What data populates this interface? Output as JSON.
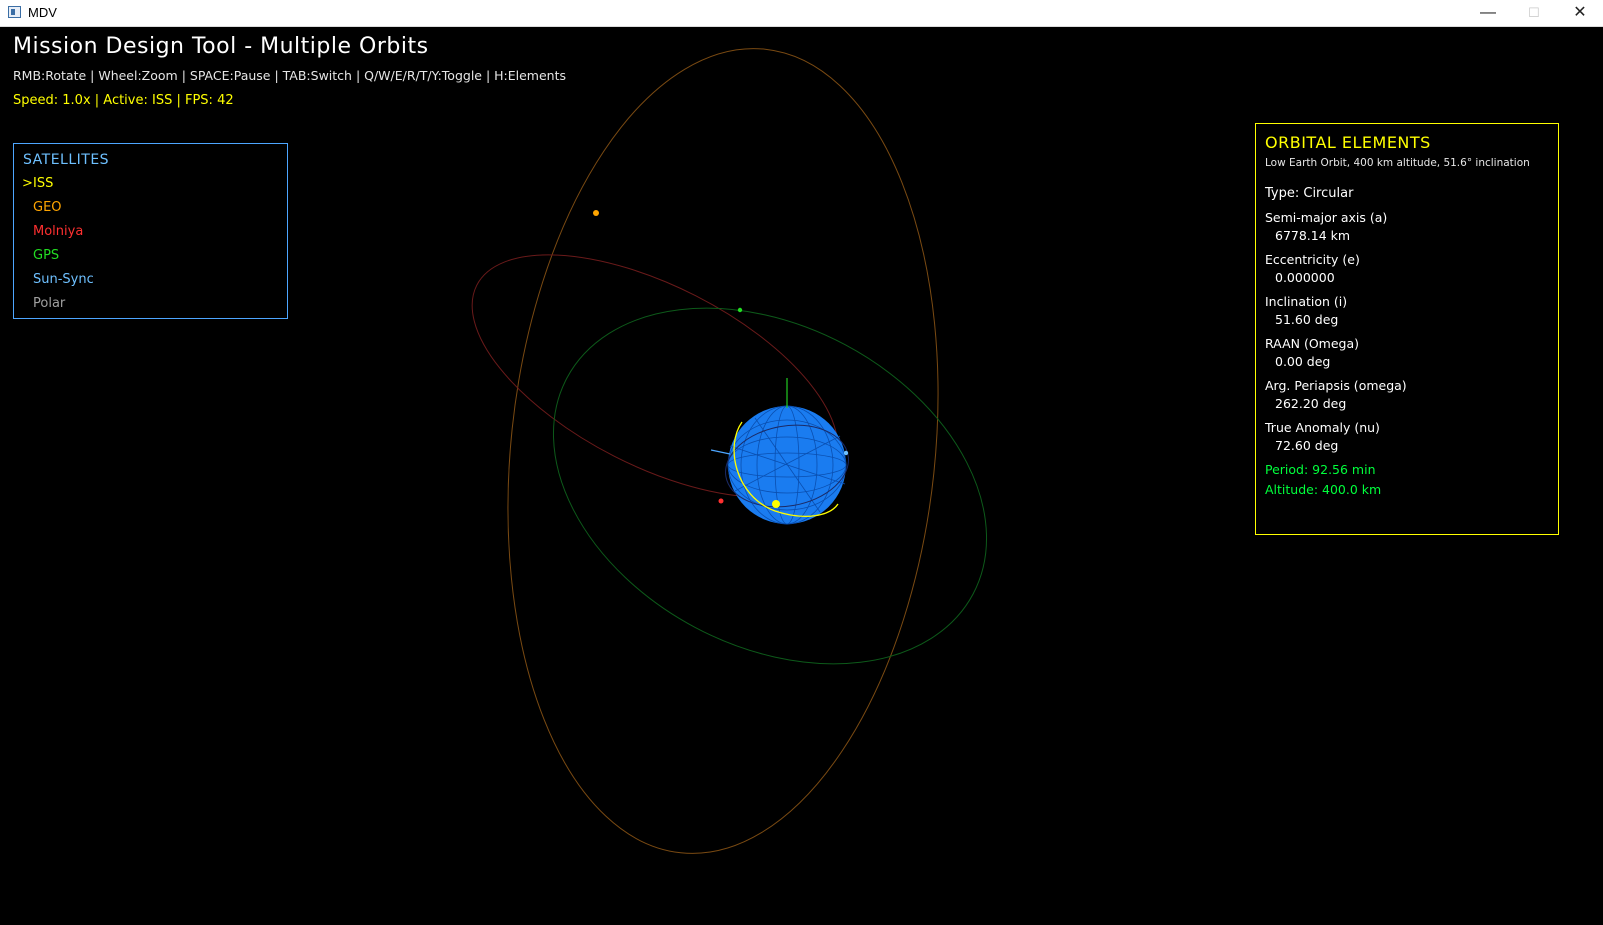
{
  "window": {
    "title": "MDV"
  },
  "hud": {
    "title": "Mission Design Tool - Multiple Orbits",
    "help": "RMB:Rotate | Wheel:Zoom | SPACE:Pause | TAB:Switch | Q/W/E/R/T/Y:Toggle | H:Elements",
    "status": "Speed: 1.0x | Active: ISS | FPS: 42"
  },
  "satellites": {
    "heading": "SATELLITES",
    "selected_marker": ">",
    "items": [
      {
        "label": "ISS",
        "color": "#ffff00"
      },
      {
        "label": "GEO",
        "color": "#ffa500"
      },
      {
        "label": "Molniya",
        "color": "#ff3030"
      },
      {
        "label": "GPS",
        "color": "#22dd22"
      },
      {
        "label": "Sun-Sync",
        "color": "#6ec0ff"
      },
      {
        "label": "Polar",
        "color": "#a0a0a0"
      }
    ]
  },
  "elements": {
    "heading": "ORBITAL ELEMENTS",
    "description": "Low Earth Orbit, 400 km altitude, 51.6° inclination",
    "type": "Type: Circular",
    "fields": [
      {
        "label": "Semi-major axis (a)",
        "value": "6778.14 km"
      },
      {
        "label": "Eccentricity (e)",
        "value": "0.000000"
      },
      {
        "label": "Inclination (i)",
        "value": "51.60 deg"
      },
      {
        "label": "RAAN (Omega)",
        "value": "0.00 deg"
      },
      {
        "label": "Arg. Periapsis (omega)",
        "value": "262.20 deg"
      },
      {
        "label": "True Anomaly (nu)",
        "value": "72.60 deg"
      }
    ],
    "period": "Period: 92.56 min",
    "altitude": "Altitude: 400.0 km"
  },
  "scene": {
    "earth_color": "#1a7cf0",
    "orbit_colors": {
      "iss": "#ffff00",
      "geo": "#7a4a12",
      "molniya": "#6a1a1a",
      "gps": "#0d5a1a",
      "sunsync": "#4da6ff"
    }
  }
}
